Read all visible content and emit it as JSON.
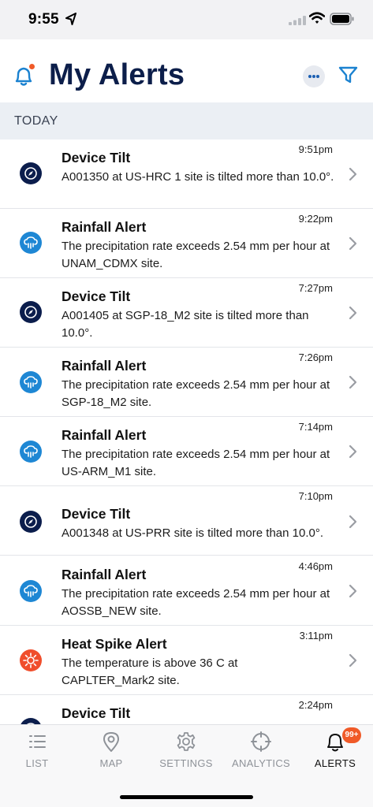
{
  "status_bar": {
    "time": "9:55"
  },
  "header": {
    "title": "My Alerts"
  },
  "section": {
    "label": "TODAY"
  },
  "alerts": [
    {
      "type": "tilt",
      "icon": "compass-icon",
      "title": "Device Tilt",
      "time": "9:51pm",
      "message": "A001350 at US-HRC 1 site is tilted more than 10.0°."
    },
    {
      "type": "rain",
      "icon": "rain-cloud-icon",
      "title": "Rainfall Alert",
      "time": "9:22pm",
      "message": "The precipitation rate exceeds 2.54 mm per hour at UNAM_CDMX site."
    },
    {
      "type": "tilt",
      "icon": "compass-icon",
      "title": "Device Tilt",
      "time": "7:27pm",
      "message": "A001405 at SGP-18_M2 site is tilted more than 10.0°."
    },
    {
      "type": "rain",
      "icon": "rain-cloud-icon",
      "title": "Rainfall Alert",
      "time": "7:26pm",
      "message": "The precipitation rate exceeds 2.54 mm per hour at SGP-18_M2 site."
    },
    {
      "type": "rain",
      "icon": "rain-cloud-icon",
      "title": "Rainfall Alert",
      "time": "7:14pm",
      "message": "The precipitation rate exceeds 2.54 mm per hour at US-ARM_M1 site."
    },
    {
      "type": "tilt",
      "icon": "compass-icon",
      "title": "Device Tilt",
      "time": "7:10pm",
      "message": "A001348 at US-PRR site is tilted more than 10.0°."
    },
    {
      "type": "rain",
      "icon": "rain-cloud-icon",
      "title": "Rainfall Alert",
      "time": "4:46pm",
      "message": "The precipitation rate exceeds 2.54 mm per hour at AOSSB_NEW site."
    },
    {
      "type": "heat",
      "icon": "sun-icon",
      "title": "Heat Spike Alert",
      "time": "3:11pm",
      "message": "The temperature is above 36 C at CAPLTER_Mark2 site."
    },
    {
      "type": "tilt",
      "icon": "compass-icon",
      "title": "Device Tilt",
      "time": "2:24pm",
      "message": ""
    }
  ],
  "tabs": [
    {
      "label": "LIST",
      "icon": "list-icon"
    },
    {
      "label": "MAP",
      "icon": "map-pin-icon"
    },
    {
      "label": "SETTINGS",
      "icon": "gear-icon"
    },
    {
      "label": "ANALYTICS",
      "icon": "crosshair-icon"
    },
    {
      "label": "ALERTS",
      "icon": "bell-icon",
      "badge": "99+",
      "active": true
    }
  ],
  "colors": {
    "brand_navy": "#0c1e4a",
    "rain_blue": "#1e87d4",
    "heat_orange": "#f04e2c",
    "badge_orange": "#f05a28",
    "accent_blue": "#1b82d0"
  }
}
